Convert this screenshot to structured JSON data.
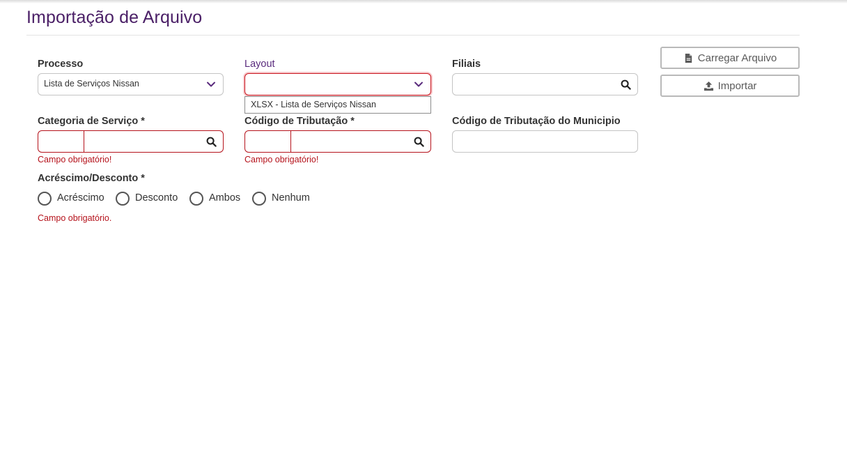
{
  "page": {
    "title": "Importação de Arquivo"
  },
  "form": {
    "processo": {
      "label": "Processo",
      "value": "Lista de Serviços Nissan"
    },
    "layout": {
      "label": "Layout",
      "value": "",
      "options": [
        "XLSX - Lista de Serviços Nissan"
      ]
    },
    "filiais": {
      "label": "Filiais",
      "value": ""
    },
    "categoria_servico": {
      "label": "Categoria de Serviço *",
      "code": "",
      "description": "",
      "error": "Campo obrigatório!"
    },
    "codigo_tributacao": {
      "label": "Código de Tributação *",
      "code": "",
      "description": "",
      "error": "Campo obrigatório!"
    },
    "codigo_tributacao_municipio": {
      "label": "Código de Tributação do Municipio",
      "value": ""
    },
    "acrescimo_desconto": {
      "label": "Acréscimo/Desconto *",
      "options": [
        "Acréscimo",
        "Desconto",
        "Ambos",
        "Nenhum"
      ],
      "error": "Campo obrigatório."
    }
  },
  "actions": {
    "carregar_label": "Carregar Arquivo",
    "importar_label": "Importar"
  },
  "icons": {
    "chevron": "chevron-down-icon",
    "search": "search-icon",
    "file": "file-icon",
    "upload": "upload-icon"
  },
  "colors": {
    "title": "#4b2067",
    "accent": "#5a2b7d",
    "error": "#b5121b"
  }
}
